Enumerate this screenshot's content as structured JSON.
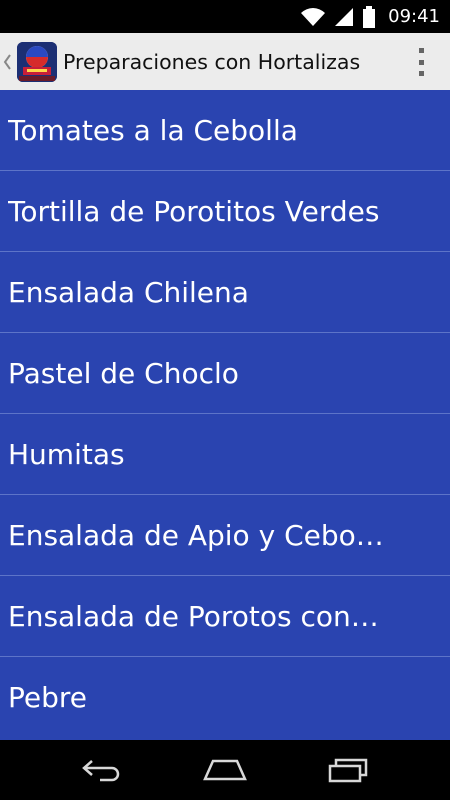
{
  "status_bar": {
    "time": "09:41",
    "icons": [
      "wifi-icon",
      "signal-icon",
      "battery-icon"
    ]
  },
  "action_bar": {
    "title": "Preparaciones con Hortalizas",
    "up_icon": "chevron-left-icon",
    "app_icon": "recipes-app-icon",
    "menu_icon": "overflow-menu-icon"
  },
  "list": {
    "items": [
      {
        "label": "Tomates a la Cebolla"
      },
      {
        "label": "Tortilla de Porotitos Verdes"
      },
      {
        "label": "Ensalada Chilena"
      },
      {
        "label": "Pastel de Choclo"
      },
      {
        "label": "Humitas"
      },
      {
        "label": "Ensalada de Apio y Cebolla"
      },
      {
        "label": "Ensalada de Porotos con…"
      },
      {
        "label": "Pebre"
      }
    ]
  },
  "nav_bar": {
    "buttons": [
      "back-icon",
      "home-icon",
      "recent-apps-icon"
    ]
  },
  "colors": {
    "list_background": "#2a44b0",
    "list_divider": "#5d74c8",
    "action_bar": "#ececec"
  }
}
